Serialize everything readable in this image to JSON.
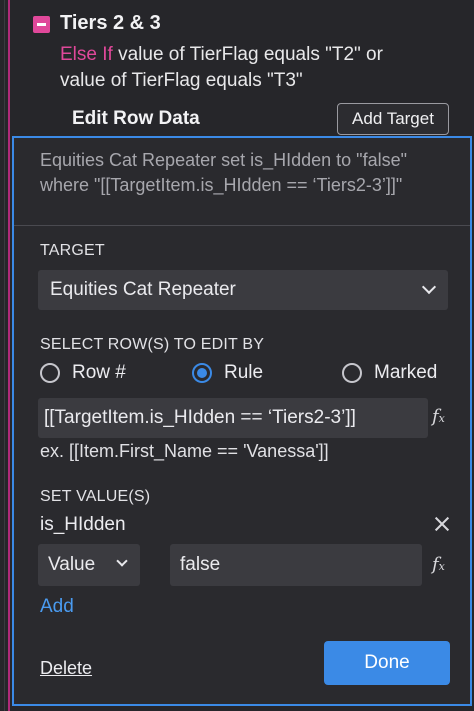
{
  "rule": {
    "title": "Tiers 2 & 3",
    "else_if": "Else If",
    "condition_line1": " value of TierFlag equals \"T2\" or",
    "condition_line2": "value of TierFlag equals \"T3\""
  },
  "edit_row": {
    "title": "Edit Row Data",
    "add_target_label": "Add Target"
  },
  "panel": {
    "summary": "Equities Cat Repeater set is_HIdden to \"false\" where \"[[TargetItem.is_HIdden == ‘Tiers2-3’]]\"",
    "target_label": "TARGET",
    "target_value": "Equities Cat Repeater",
    "select_rows_label": "SELECT ROW(S) TO EDIT BY",
    "radio_options": [
      "Row #",
      "Rule",
      "Marked"
    ],
    "selected_option": "Rule",
    "rule_expression": "[[TargetItem.is_HIdden == ‘Tiers2-3’]]",
    "example": "ex. [[Item.First_Name == 'Vanessa']]",
    "set_values_label": "SET VALUE(S)",
    "field_name": "is_HIdden",
    "value_type": "Value",
    "value": "false",
    "add_label": "Add",
    "delete_label": "Delete",
    "done_label": "Done"
  },
  "colors": {
    "accent_blue": "#3b8ae6",
    "accent_pink": "#e0489a",
    "background": "#26262a"
  },
  "icons": [
    "minus-icon",
    "chevron-down-icon",
    "fx-icon",
    "close-icon"
  ]
}
